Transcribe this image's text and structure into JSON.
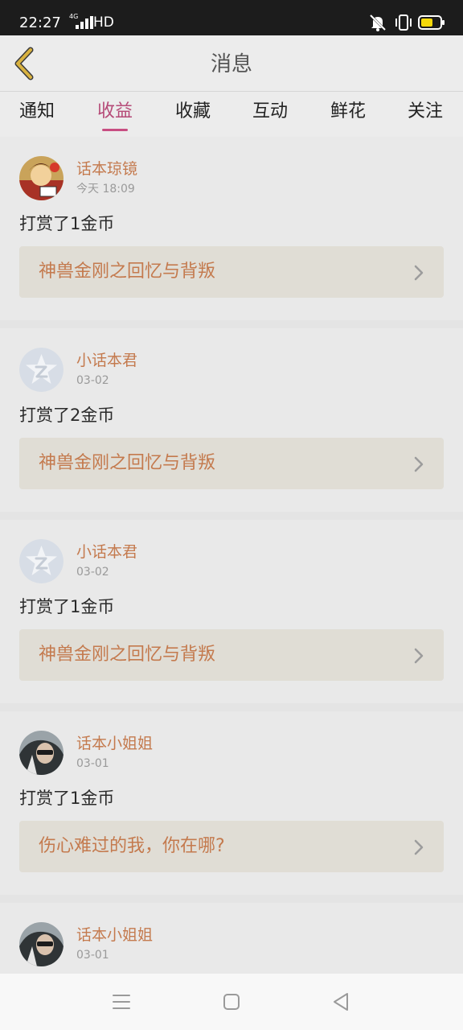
{
  "status_bar": {
    "time": "22:27",
    "network_type": "4G",
    "hd_label": "HD",
    "battery_color": "#f5d90a"
  },
  "header": {
    "title": "消息",
    "back_icon": "chevron-left-icon",
    "accent_color": "#d9b240"
  },
  "tabs": [
    {
      "label": "通知",
      "active": false
    },
    {
      "label": "收益",
      "active": true
    },
    {
      "label": "收藏",
      "active": false
    },
    {
      "label": "互动",
      "active": false
    },
    {
      "label": "鲜花",
      "active": false
    },
    {
      "label": "关注",
      "active": false
    }
  ],
  "messages": [
    {
      "user": "话本琼镜",
      "time": "今天 18:09",
      "action": "打赏了1金币",
      "title": "神兽金刚之回忆与背叛",
      "avatar": "comic-avatar"
    },
    {
      "user": "小话本君",
      "time": "03-02",
      "action": "打赏了2金币",
      "title": "神兽金刚之回忆与背叛",
      "avatar": "star-logo-avatar"
    },
    {
      "user": "小话本君",
      "time": "03-02",
      "action": "打赏了1金币",
      "title": "神兽金刚之回忆与背叛",
      "avatar": "star-logo-avatar"
    },
    {
      "user": "话本小姐姐",
      "time": "03-01",
      "action": "打赏了1金币",
      "title": "伤心难过的我，你在哪?",
      "avatar": "photo-avatar"
    },
    {
      "user": "话本小姐姐",
      "time": "03-01",
      "action": "",
      "title": "",
      "avatar": "photo-avatar"
    }
  ],
  "nav_bar": {
    "menu_icon": "menu-icon",
    "home_icon": "home-icon",
    "back_icon": "back-triangle-icon"
  }
}
